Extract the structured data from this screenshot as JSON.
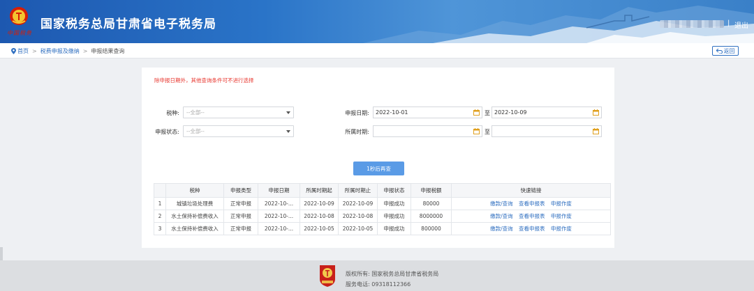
{
  "header": {
    "logo_text": "中国税务",
    "title": "国家税务总局甘肃省电子税务局",
    "separator": "|",
    "logout_label": "退出"
  },
  "breadcrumb": {
    "home": "首页",
    "sep1": ">",
    "level2": "税费申报及缴纳",
    "sep2": ">",
    "current": "申报结果查询",
    "back_label": "返回"
  },
  "form": {
    "warning": "除申报日期外，其他查询条件可不进行选择",
    "tax_type_label": "税种:",
    "tax_type_value": "--全部--",
    "status_label": "申报状态:",
    "status_value": "--全部--",
    "declare_date_label": "申报日期:",
    "declare_date_from": "2022-10-01",
    "declare_date_to_label": "至",
    "declare_date_to": "2022-10-09",
    "period_label": "所属时期:",
    "period_from": "",
    "period_to_label": "至",
    "period_to": "",
    "query_button": "1秒后再查"
  },
  "table": {
    "columns": [
      "",
      "税种",
      "申报类型",
      "申报日期",
      "所属时期起",
      "所属时期止",
      "申报状态",
      "申报税额",
      "快速链接"
    ],
    "rows": [
      {
        "no": "1",
        "tax": "城镇垃圾处理费",
        "type": "正常申报",
        "date": "2022-10-...",
        "start": "2022-10-09",
        "end": "2022-10-09",
        "status": "申报成功",
        "amount": "80000"
      },
      {
        "no": "2",
        "tax": "水土保持补偿费收入",
        "type": "正常申报",
        "date": "2022-10-...",
        "start": "2022-10-08",
        "end": "2022-10-08",
        "status": "申报成功",
        "amount": "8000000"
      },
      {
        "no": "3",
        "tax": "水土保持补偿费收入",
        "type": "正常申报",
        "date": "2022-10-...",
        "start": "2022-10-05",
        "end": "2022-10-05",
        "status": "申报成功",
        "amount": "800000"
      }
    ],
    "links": [
      "缴款/查询",
      "查看申报表",
      "申报作废"
    ]
  },
  "footer": {
    "badge_text": "税徽标识",
    "copyright": "版权所有: 国家税务总局甘肃省税务局",
    "phone": "服务电话: 09318112366"
  },
  "colors": {
    "header_blue": "#2a74c8",
    "link_blue": "#2f6fc0",
    "warning_red": "#e8372f",
    "button_blue": "#5a9be6"
  }
}
